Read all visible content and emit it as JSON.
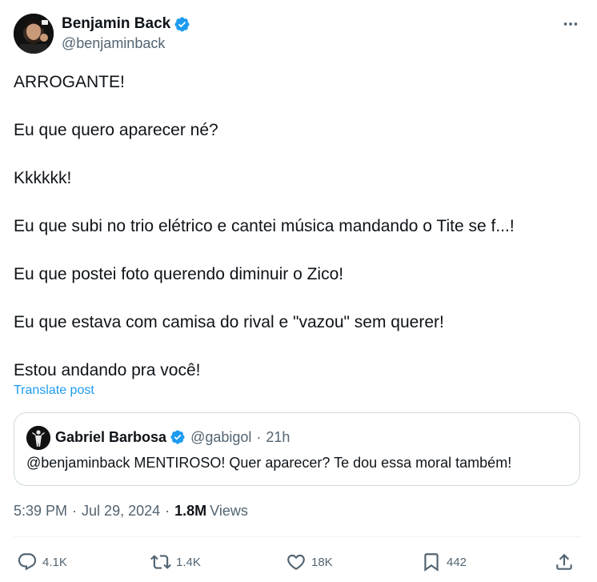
{
  "author": {
    "display_name": "Benjamin Back",
    "handle": "@benjaminback",
    "verified": true
  },
  "post": {
    "lines": [
      "ARROGANTE!",
      "Eu que quero aparecer né?",
      "Kkkkkk!",
      "Eu que subi no trio elétrico e cantei música mandando o Tite se f...!",
      "Eu que postei foto querendo diminuir o Zico!",
      "Eu que estava com camisa do rival e \"vazou\" sem querer!",
      "Estou andando pra você!"
    ],
    "translate_label": "Translate post"
  },
  "quoted_post": {
    "display_name": "Gabriel Barbosa",
    "handle": "@gabigol",
    "separator": "·",
    "time": "21h",
    "text": "@benjaminback MENTIROSO! Quer aparecer? Te dou essa moral também!"
  },
  "meta": {
    "time": "5:39 PM",
    "separator": "·",
    "date": "Jul 29, 2024",
    "views_count": "1.8M",
    "views_label": "Views"
  },
  "actions": {
    "replies": "4.1K",
    "reposts": "1.4K",
    "likes": "18K",
    "bookmarks": "442"
  },
  "icons": {
    "verified": "verified-badge-icon",
    "more": "more-dots-icon",
    "reply": "reply-icon",
    "repost": "repost-icon",
    "like": "heart-icon",
    "bookmark": "bookmark-icon",
    "share": "share-icon"
  },
  "colors": {
    "accent": "#1d9bf0",
    "text_primary": "#0f1419",
    "text_secondary": "#536471",
    "border": "#cfd9de"
  }
}
